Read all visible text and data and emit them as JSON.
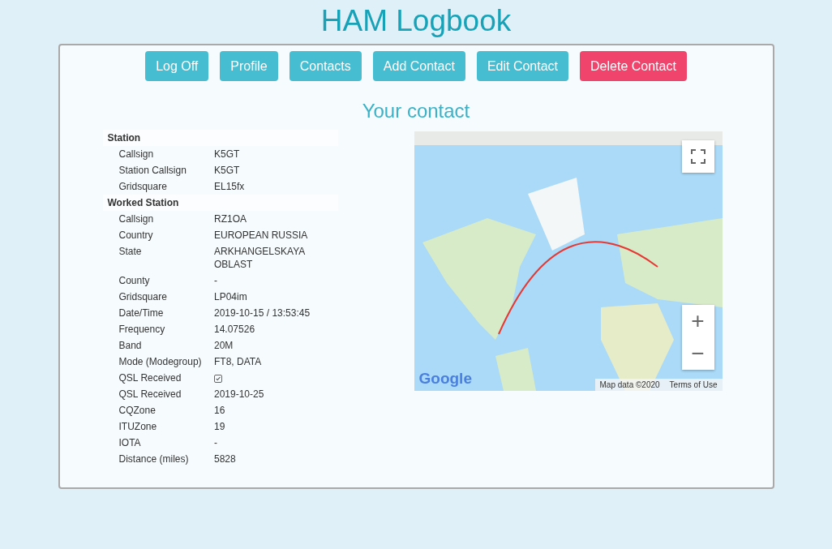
{
  "title": "HAM Logbook",
  "buttons": [
    {
      "label": "Log Off",
      "kind": "info"
    },
    {
      "label": "Profile",
      "kind": "info"
    },
    {
      "label": "Contacts",
      "kind": "info"
    },
    {
      "label": "Add Contact",
      "kind": "info"
    },
    {
      "label": "Edit Contact",
      "kind": "info"
    },
    {
      "label": "Delete Contact",
      "kind": "danger"
    }
  ],
  "heading": "Your contact",
  "sections": [
    {
      "title": "Station",
      "rows": [
        {
          "label": "Callsign",
          "value": "K5GT"
        },
        {
          "label": "Station Callsign",
          "value": "K5GT"
        },
        {
          "label": "Gridsquare",
          "value": "EL15fx"
        }
      ]
    },
    {
      "title": "Worked Station",
      "rows": [
        {
          "label": "Callsign",
          "value": "RZ1OA"
        },
        {
          "label": "Country",
          "value": "EUROPEAN RUSSIA"
        },
        {
          "label": "State",
          "value": "ARKHANGELSKAYA OBLAST"
        },
        {
          "label": "County",
          "value": "-"
        },
        {
          "label": "Gridsquare",
          "value": "LP04im"
        },
        {
          "label": "Date/Time",
          "value": "2019-10-15 / 13:53:45"
        },
        {
          "label": "Frequency",
          "value": "14.07526"
        },
        {
          "label": "Band",
          "value": "20M"
        },
        {
          "label": "Mode (Modegroup)",
          "value": "FT8, DATA"
        },
        {
          "label": "QSL Received",
          "kind": "check",
          "checked": true
        },
        {
          "label": "QSL Received",
          "value": "2019-10-25"
        },
        {
          "label": "CQZone",
          "value": "16"
        },
        {
          "label": "ITUZone",
          "value": "19"
        },
        {
          "label": "IOTA",
          "value": "-"
        },
        {
          "label": "Distance (miles)",
          "value": "5828"
        }
      ]
    }
  ],
  "map": {
    "zoom_in": "+",
    "zoom_out": "−",
    "logo": "Google",
    "attribution": "Map data ©2020",
    "terms": "Terms of Use"
  }
}
